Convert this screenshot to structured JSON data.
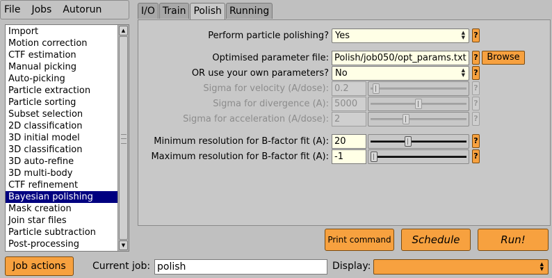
{
  "menu": [
    "File",
    "Jobs",
    "Autorun"
  ],
  "job_list": {
    "items": [
      "Import",
      "Motion correction",
      "CTF estimation",
      "Manual picking",
      "Auto-picking",
      "Particle extraction",
      "Particle sorting",
      "Subset selection",
      "2D classification",
      "3D initial model",
      "3D classification",
      "3D auto-refine",
      "3D multi-body",
      "CTF refinement",
      "Bayesian polishing",
      "Mask creation",
      "Join star files",
      "Particle subtraction",
      "Post-processing"
    ],
    "selected": "Bayesian polishing"
  },
  "tabs": [
    "I/O",
    "Train",
    "Polish",
    "Running"
  ],
  "active_tab": "Polish",
  "form": {
    "perform_polishing": {
      "label": "Perform particle polishing?",
      "value": "Yes",
      "help": "?"
    },
    "opt_param_file": {
      "label": "Optimised parameter file:",
      "value": "Polish/job050/opt_params.txt",
      "help": "?",
      "browse": "Browse"
    },
    "own_params": {
      "label": "OR use your own parameters?",
      "value": "No",
      "help": "?"
    },
    "sigma_velocity": {
      "label": "Sigma for velocity (A/dose):",
      "value": "0.2",
      "help": "?",
      "slider_fraction": 0.02
    },
    "sigma_divergence": {
      "label": "Sigma for divergence (A):",
      "value": "5000",
      "help": "?",
      "slider_fraction": 0.5
    },
    "sigma_acceleration": {
      "label": "Sigma for acceleration (A/dose):",
      "value": "2",
      "help": "?",
      "slider_fraction": 0.36
    },
    "min_res": {
      "label": "Minimum resolution for B-factor fit (A):",
      "value": "20",
      "help": "?",
      "slider_fraction": 0.38
    },
    "max_res": {
      "label": "Maximum resolution for B-factor fit (A):",
      "value": "-1",
      "help": "?",
      "slider_fraction": 0.0
    }
  },
  "buttons": {
    "print": "Print command",
    "schedule": "Schedule",
    "run": "Run!"
  },
  "footer": {
    "job_actions": "Job actions",
    "current_job_label": "Current job:",
    "current_job_value": "polish",
    "display_label": "Display:",
    "display_value": ""
  }
}
